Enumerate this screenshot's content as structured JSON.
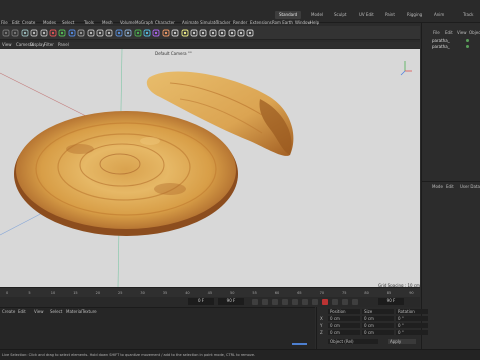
{
  "menubar": {
    "items": [
      "File",
      "Edit",
      "Create",
      "Modes",
      "Select",
      "Tools",
      "Mesh",
      "Volume",
      "MoGraph",
      "Character",
      "Animate",
      "Simulate",
      "Tracker",
      "Render",
      "Extensions",
      "Rom Earth",
      "Window",
      "Help"
    ]
  },
  "layouts": {
    "active": "Standard",
    "items": [
      "Standard",
      "Model",
      "Sculpt",
      "UV Edit",
      "Paint",
      "Rigging",
      "Anim",
      "Track"
    ]
  },
  "viewport": {
    "menu": [
      "View",
      "Cameras",
      "Display",
      "Filter",
      "Panel"
    ],
    "camera_label": "Default Camera °°",
    "grid_spacing": "Grid Spacing : 10 cm",
    "background": "#d8d8d8"
  },
  "object_manager": {
    "menu": [
      "File",
      "Edit",
      "View",
      "Object"
    ],
    "objects": [
      "paratha_",
      "paratha_"
    ]
  },
  "attribute_manager": {
    "menu": [
      "Mode",
      "Edit",
      "User Data"
    ]
  },
  "timeline": {
    "ticks": [
      "0",
      "5",
      "10",
      "15",
      "20",
      "25",
      "30",
      "35",
      "40",
      "45",
      "50",
      "55",
      "60",
      "65",
      "70",
      "75",
      "80",
      "85",
      "90"
    ],
    "current_frame": "0 F",
    "end_frame": "90 F",
    "start_field": "0 F",
    "max_field": "90 F"
  },
  "material_manager": {
    "menu": [
      "Create",
      "Edit",
      "View",
      "Select",
      "Material",
      "Texture"
    ]
  },
  "coordinates": {
    "headers": [
      "Position",
      "Size",
      "Rotation"
    ],
    "rows": [
      {
        "axis": "X",
        "pos": "0 cm",
        "size": "0 cm",
        "rot": "0 °"
      },
      {
        "axis": "Y",
        "pos": "0 cm",
        "size": "0 cm",
        "rot": "0 °"
      },
      {
        "axis": "Z",
        "pos": "0 cm",
        "size": "0 cm",
        "rot": "0 °"
      }
    ],
    "mode": "Object (Rel)",
    "apply_label": "Apply"
  },
  "status": {
    "text": "Live Selection: Click and drag to select elements. Hold down SHIFT to quantize movement / add to the selection in point mode, CTRL to remove."
  },
  "colors": {
    "accent": "#4d7fd0",
    "bread_light": "#e2b25d",
    "bread_dark": "#b7702a"
  }
}
